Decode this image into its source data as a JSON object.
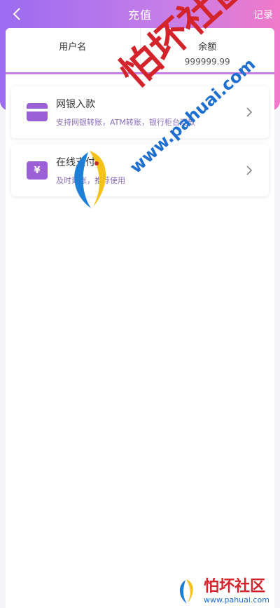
{
  "header": {
    "title": "充值",
    "record_label": "记录"
  },
  "info": {
    "username_label": "用户名",
    "username_value": "",
    "balance_label": "余额",
    "balance_value": "999999.99"
  },
  "methods": [
    {
      "name": "网银入款",
      "desc": "支持网银转账，ATM转账，银行柜台汇款",
      "icon": "card-icon"
    },
    {
      "name": "在线支付",
      "desc": "及时到账，推荐使用",
      "icon": "yen-icon"
    }
  ],
  "watermark": {
    "brand": "怕坏社区",
    "url": "www.pahuai.com"
  },
  "colors": {
    "accent": "#9b5fd6",
    "gradient_start": "#9b6bf0",
    "gradient_end": "#f07ac8"
  }
}
